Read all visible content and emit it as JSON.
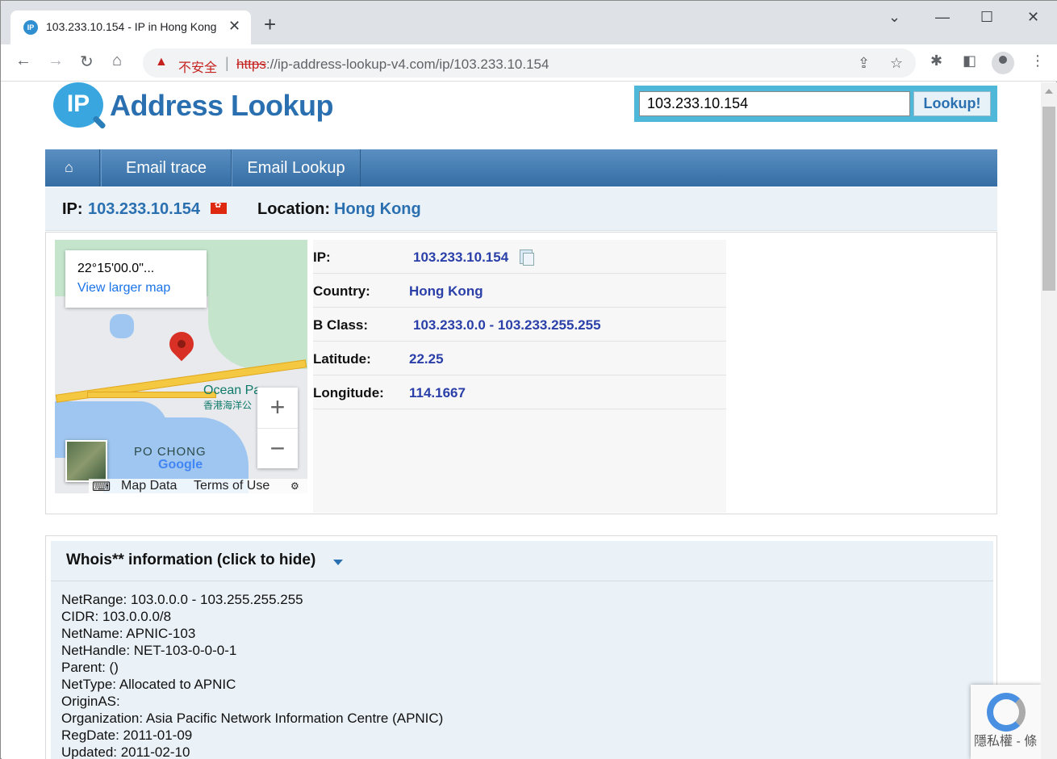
{
  "browser": {
    "tab_title": "103.233.10.154 - IP in Hong Kong",
    "tab_close": "✕",
    "new_tab": "+",
    "not_secure": "不安全",
    "url_scheme": "https",
    "url_rest": "://ip-address-lookup-v4.com/ip/103.233.10.154"
  },
  "site": {
    "logo_mark": "IP",
    "logo_text": "Address Lookup",
    "search_value": "103.233.10.154",
    "search_button": "Lookup!"
  },
  "nav": {
    "items": [
      {
        "label": "Email trace"
      },
      {
        "label": "Email Lookup"
      }
    ]
  },
  "summary": {
    "ip_label": "IP:",
    "ip_value": "103.233.10.154",
    "location_label": "Location:",
    "location_value": "Hong Kong"
  },
  "map": {
    "coord": "22°15'00.0\"...",
    "larger_link": "View larger map",
    "place_ocean": "Ocean Pa",
    "place_ocean_zh": "香港海洋公",
    "place_pochong": "PO CHONG",
    "google": "Google",
    "footer_map_data": "Map Data",
    "footer_terms": "Terms of Use",
    "zoom_in": "+",
    "zoom_out": "−"
  },
  "details": [
    {
      "label": "IP:",
      "value": "103.233.10.154"
    },
    {
      "label": "Country:",
      "value": "Hong Kong"
    },
    {
      "label": "B Class:",
      "value": "103.233.0.0 - 103.233.255.255"
    },
    {
      "label": "Latitude:",
      "value": "22.25"
    },
    {
      "label": "Longitude:",
      "value": "114.1667"
    }
  ],
  "whois": {
    "title": "Whois** information (click to hide)",
    "lines": [
      "NetRange: 103.0.0.0 - 103.255.255.255",
      "CIDR: 103.0.0.0/8",
      "NetName: APNIC-103",
      "NetHandle: NET-103-0-0-0-1",
      "Parent: ()",
      "NetType: Allocated to APNIC",
      "OriginAS:",
      "Organization: Asia Pacific Network Information Centre (APNIC)",
      "RegDate: 2011-01-09",
      "Updated: 2011-02-10"
    ]
  },
  "recaptcha": {
    "text": "隱私權 - 條"
  },
  "colors": {
    "brand_blue": "#2a6fb0",
    "nav_blue": "#356ea4",
    "value_blue": "#2a3fa8",
    "not_secure_red": "#c5221f"
  }
}
